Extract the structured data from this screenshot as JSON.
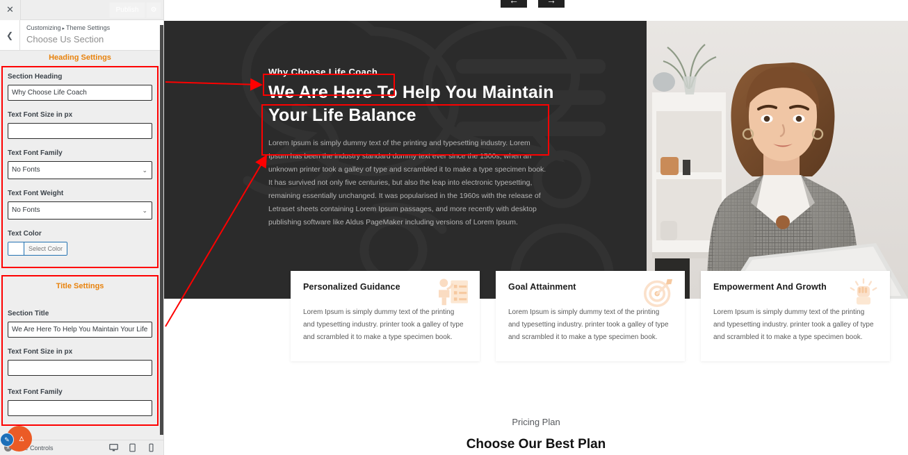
{
  "customizer": {
    "close_icon": "close-icon",
    "publish_label": "Publish",
    "gear_icon": "gear-icon",
    "back_icon": "chevron-left-icon",
    "breadcrumb_root": "Customizing",
    "breadcrumb_sep": "▸",
    "breadcrumb_parent": "Theme Settings",
    "section_name": "Choose Us Section",
    "groups": [
      {
        "title": "Heading Settings",
        "fields": [
          {
            "type": "text",
            "label": "Section Heading",
            "value": "Why Choose Life Coach",
            "placeholder": ""
          },
          {
            "type": "text",
            "label": "Text Font Size in px",
            "value": "",
            "placeholder": ""
          },
          {
            "type": "select",
            "label": "Text Font Family",
            "value": "No Fonts"
          },
          {
            "type": "select",
            "label": "Text Font Weight",
            "value": "No Fonts"
          },
          {
            "type": "color",
            "label": "Text Color",
            "value": "Select Color",
            "swatch": "#ffffff"
          }
        ]
      },
      {
        "title": "Title Settings",
        "fields": [
          {
            "type": "text",
            "label": "Section Title",
            "value": "We Are Here To Help You Maintain Your Life Balance",
            "placeholder": ""
          },
          {
            "type": "text",
            "label": "Text Font Size in px",
            "value": "",
            "placeholder": ""
          },
          {
            "type": "select",
            "label": "Text Font Family",
            "value": ""
          }
        ]
      }
    ],
    "footer": {
      "hide_controls_label": "Hide Controls",
      "hide_icon": "eye-hide-icon",
      "devices": [
        {
          "icon": "desktop-icon",
          "active": true
        },
        {
          "icon": "tablet-icon",
          "active": false
        },
        {
          "icon": "mobile-icon",
          "active": false
        }
      ]
    },
    "accent_orange": "#e8820c",
    "annotation_red": "#fe0000"
  },
  "preview": {
    "slider": {
      "prev_icon": "arrow-left-icon",
      "next_icon": "arrow-right-icon"
    },
    "hero": {
      "eyebrow": "Why Choose Life Coach",
      "title": "We Are Here To Help You Maintain Your Life Balance",
      "paragraph": "Lorem Ipsum is simply dummy text of the printing and typesetting industry. Lorem Ipsum has been the industry standard dummy text ever since the 1500s, when an unknown printer took a galley of type and scrambled it to make a type specimen book. It has survived not only five centuries, but also the leap into electronic typesetting, remaining essentially unchanged. It was popularised in the 1960s with the release of Letraset sheets containing Lorem Ipsum passages, and more recently with desktop publishing software like Aldus PageMaker including versions of Lorem Ipsum.",
      "background_color": "#2b2b2b",
      "photo_alt": "woman-at-laptop-photo"
    },
    "cards": [
      {
        "title": "Personalized Guidance",
        "icon": "presentation-checklist-icon",
        "text": "Lorem Ipsum is simply dummy text of the printing and typesetting industry. printer took a galley of type and scrambled it to make a type specimen book."
      },
      {
        "title": "Goal Attainment",
        "icon": "target-dart-icon",
        "text": "Lorem Ipsum is simply dummy text of the printing and typesetting industry. printer took a galley of type and scrambled it to make a type specimen book."
      },
      {
        "title": "Empowerment And Growth",
        "icon": "raised-fist-icon",
        "text": "Lorem Ipsum is simply dummy text of the printing and typesetting industry. printer took a galley of type and scrambled it to make a type specimen book."
      }
    ],
    "pricing": {
      "eyebrow": "Pricing Plan",
      "title": "Choose Our Best Plan"
    },
    "fab": {
      "chevron_icon": "chevron-up-icon",
      "badge_icon": "pencil-edit-icon",
      "color": "#eb5b26",
      "badge_color": "#1c6fb8"
    }
  }
}
